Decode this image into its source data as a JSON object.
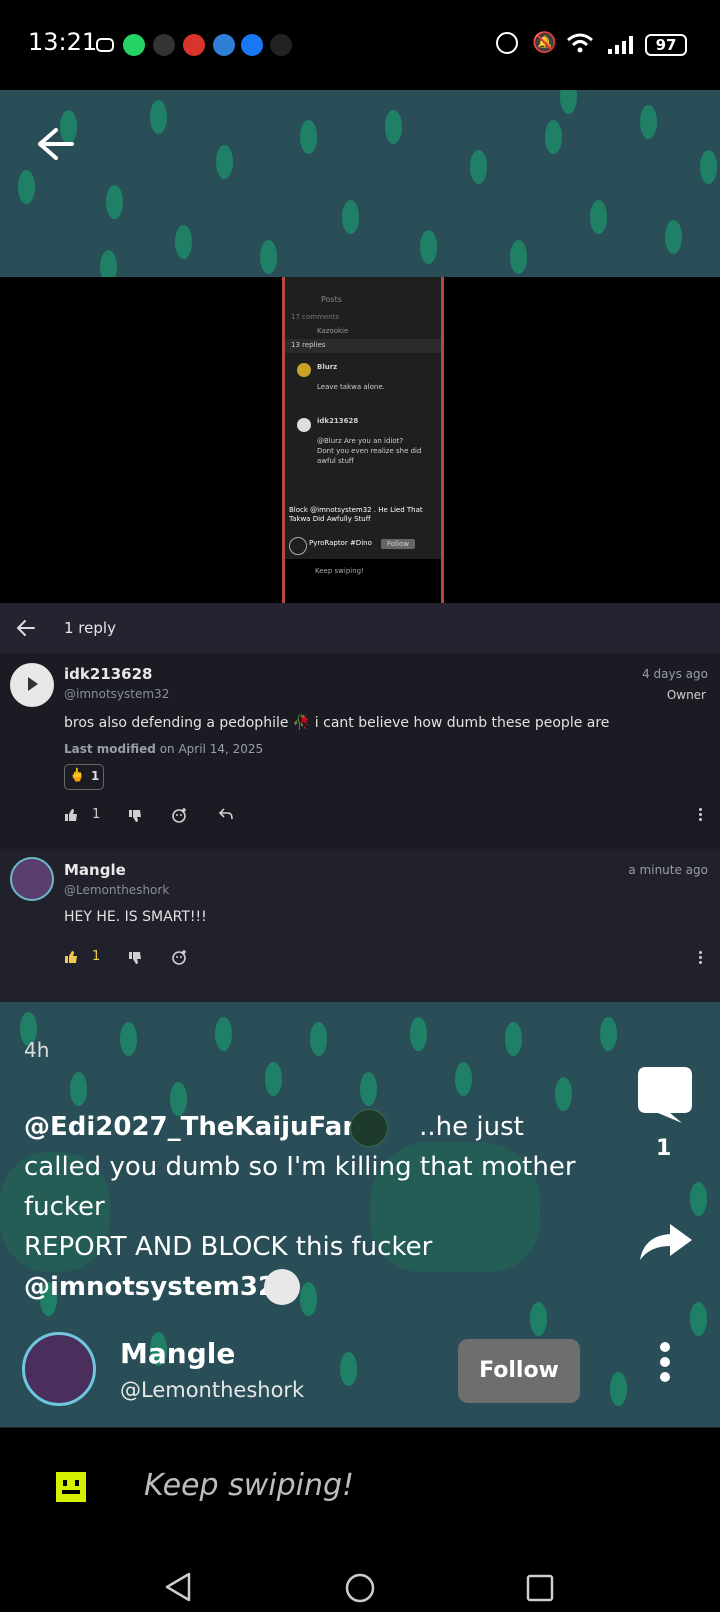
{
  "status_bar": {
    "time": "13:21",
    "battery": "97"
  },
  "embedded_screenshot": {
    "title": "Posts",
    "comments_count": "17 comments",
    "replies_count": "13 replies",
    "user1": "Kazookie",
    "blurz_name": "Blurz",
    "blurz_text": "Leave takwa alone.",
    "idk_name": "idk213628",
    "idk_text1": "@Blurz Are you an idiot?",
    "idk_text2": "Dont you even realize she did",
    "idk_text3": "awful stuff",
    "overlay_text1": "Block @imnotsystem32 . He Lied That",
    "overlay_text2": "Takwa Did Awfully Stuff",
    "pyro_name": "PyroRaptor #Dino",
    "follow": "Follow",
    "keep": "Keep swiping!"
  },
  "comments_panel": {
    "header_label": "1 reply",
    "comments": [
      {
        "name": "idk213628",
        "handle": "@imnotsystem32",
        "time": "4 days ago",
        "badge": "Owner",
        "body": "bros also defending a pedophile 🥀 i cant believe how dumb these people are",
        "modified_label": "Last modified",
        "modified_on": "on April 14, 2025",
        "reaction_count": "1",
        "like_count": "1"
      },
      {
        "name": "Mangle",
        "handle": "@Lemontheshork",
        "time": "a minute ago",
        "body": "HEY HE. IS SMART!!!",
        "like_count": "1"
      }
    ]
  },
  "post": {
    "age": "4h",
    "caption_mention": "@Edi2027_TheKaijuFan",
    "caption_line1_rest": "..he just",
    "caption_line2": "called you dumb so I'm killing that mother",
    "caption_line3": "fucker",
    "caption_line4": "REPORT AND BLOCK this fucker",
    "caption_mention2": "@imnotsystem32",
    "comment_count": "1",
    "author_name": "Mangle",
    "author_handle": "@Lemontheshork",
    "follow_label": "Follow"
  },
  "keep_swiping": "Keep swiping!",
  "colors": {
    "pattern_bg": "#2a4e57",
    "pattern_dot": "#1f8a68",
    "panel_bg": "#1b1c23",
    "like_yellow": "#f2c94c",
    "emoji_green": "#d4f200"
  }
}
